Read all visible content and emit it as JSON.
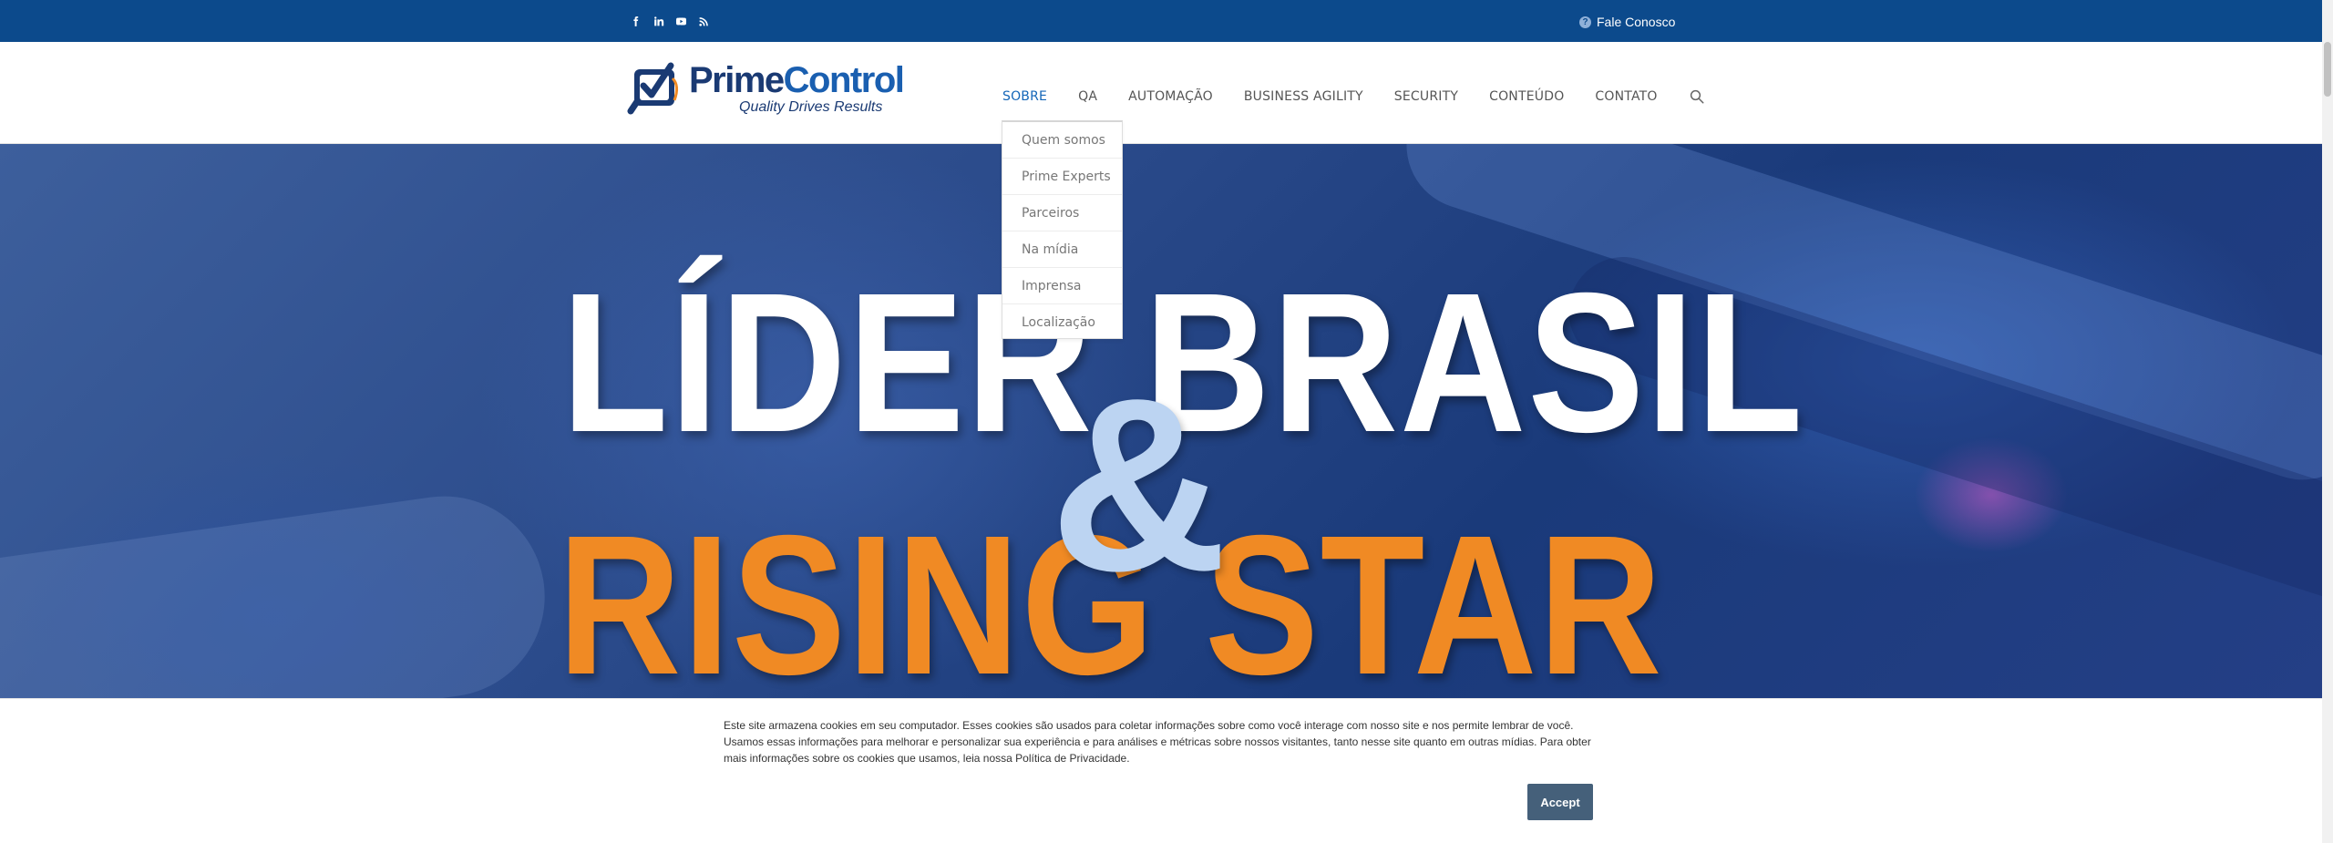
{
  "topbar": {
    "social": [
      {
        "name": "facebook"
      },
      {
        "name": "linkedin"
      },
      {
        "name": "youtube"
      },
      {
        "name": "rss"
      }
    ],
    "contact_label": "Fale Conosco"
  },
  "logo": {
    "name_part1": "Prime",
    "name_part2": "Control",
    "tagline": "Quality Drives Results"
  },
  "nav": {
    "items": [
      {
        "label": "SOBRE",
        "active": true
      },
      {
        "label": "QA"
      },
      {
        "label": "AUTOMAÇÃO"
      },
      {
        "label": "BUSINESS AGILITY"
      },
      {
        "label": "SECURITY"
      },
      {
        "label": "CONTEÚDO"
      },
      {
        "label": "CONTATO"
      }
    ],
    "dropdown": [
      "Quem somos",
      "Prime Experts",
      "Parceiros",
      "Na mídia",
      "Imprensa",
      "Localização"
    ]
  },
  "hero": {
    "line1": "LÍDER BRASIL",
    "amp": "&",
    "line2": "RISING STAR"
  },
  "cookie": {
    "text": "Este site armazena cookies em seu computador. Esses cookies são usados para coletar informações sobre como você interage com nosso site e nos permite lembrar de você. Usamos essas informações para melhorar e personalizar sua experiência e para análises e métricas sobre nossos visitantes, tanto nesse site quanto em outras mídias. Para obter mais informações sobre os cookies que usamos, leia nossa Política de Privacidade.",
    "accept_label": "Accept"
  },
  "colors": {
    "topbar": "#0c4a8c",
    "nav_active": "#1466b8",
    "hero_orange": "#f08a24",
    "accept_button": "#45607a"
  }
}
